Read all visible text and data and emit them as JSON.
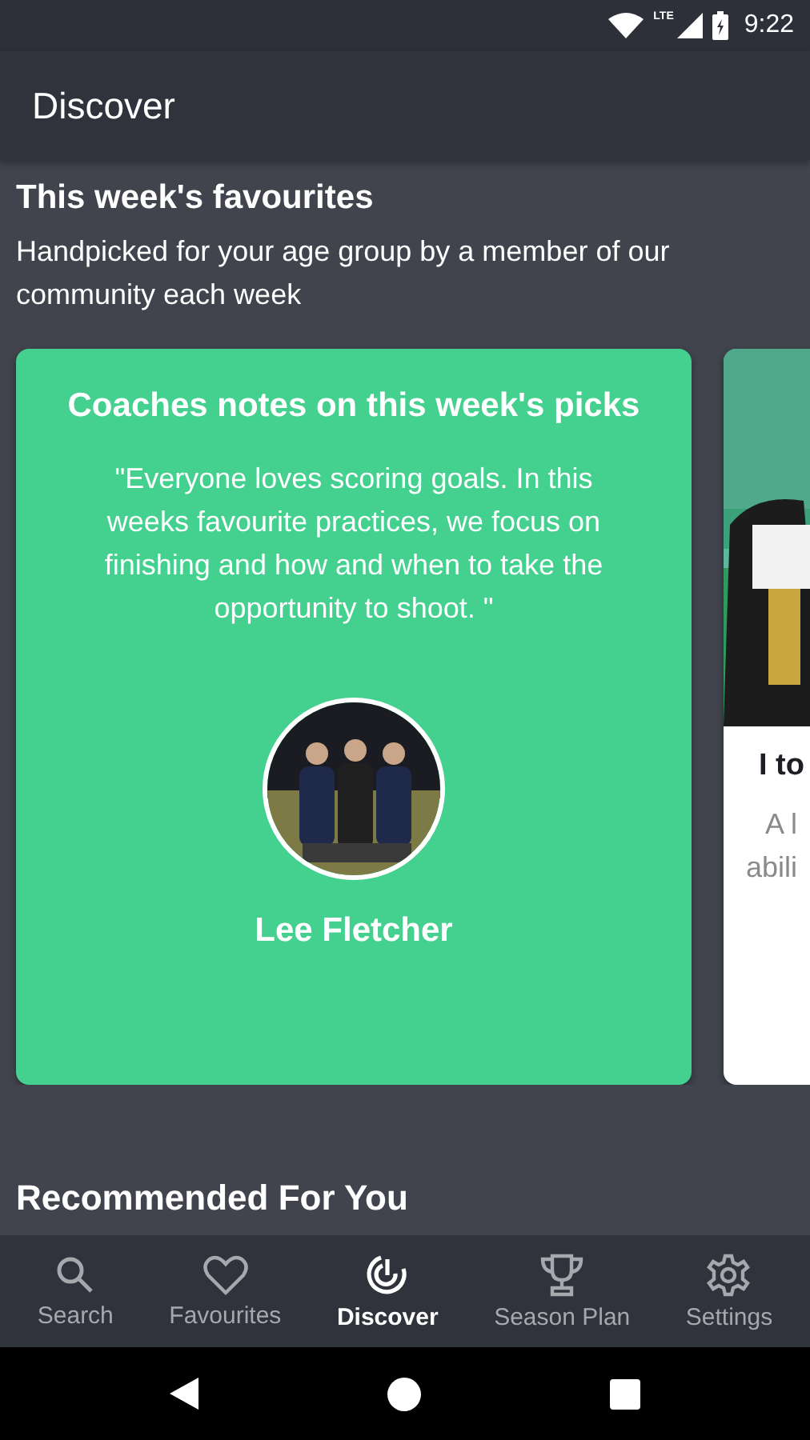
{
  "status_bar": {
    "network": "LTE",
    "time": "9:22"
  },
  "app_bar": {
    "title": "Discover"
  },
  "favourites": {
    "title": "This week's favourites",
    "subtitle": "Handpicked for your age group by a member of our community each week",
    "cards": [
      {
        "kind": "coach",
        "title": "Coaches notes on this week's picks",
        "quote": "\"Everyone loves scoring goals. In this weeks favourite practices, we focus on finishing and how and when to take the opportunity to shoot. \"",
        "name": "Lee Fletcher"
      },
      {
        "kind": "practice",
        "title": "I to",
        "description_lines": [
          "A l",
          "abili"
        ]
      }
    ]
  },
  "recommended": {
    "title": "Recommended For You"
  },
  "bottom_nav": [
    {
      "kind": "search",
      "label": "Search",
      "selected": false
    },
    {
      "kind": "heart",
      "label": "Favourites",
      "selected": false
    },
    {
      "kind": "radar",
      "label": "Discover",
      "selected": true
    },
    {
      "kind": "trophy",
      "label": "Season Plan",
      "selected": false
    },
    {
      "kind": "gear",
      "label": "Settings",
      "selected": false
    }
  ]
}
